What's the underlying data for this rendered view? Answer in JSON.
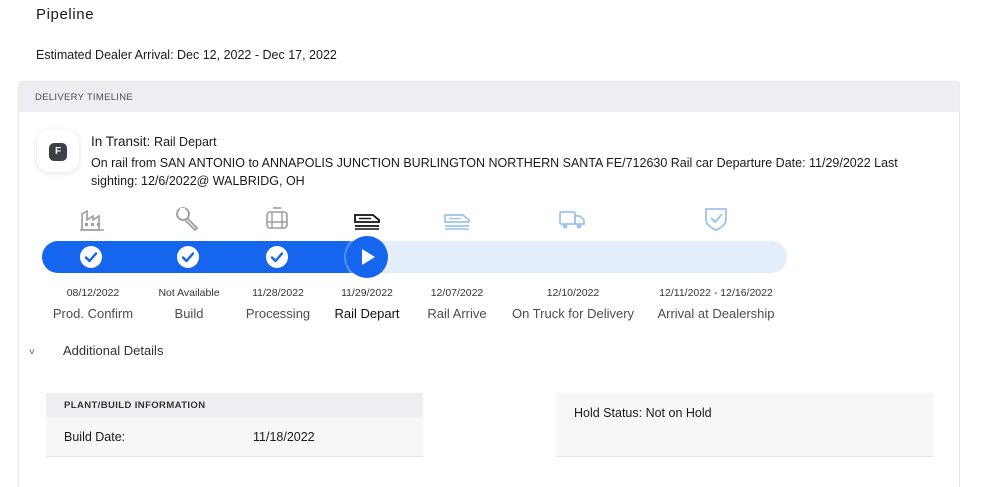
{
  "page": {
    "title": "Pipeline",
    "estimated_arrival": "Estimated Dealer Arrival: Dec 12, 2022 - Dec 17, 2022"
  },
  "timeline": {
    "header": "DELIVERY TIMELINE",
    "badge_letter": "F",
    "status_title": "In Transit:",
    "status_sub": "Rail Depart",
    "status_detail": "On rail from SAN ANTONIO to ANNAPOLIS JUNCTION BURLINGTON NORTHERN SANTA FE/712630 Rail car Departure Date: 11/29/2022 Last sighting: 12/6/2022@ WALBRIDG, OH",
    "steps": [
      {
        "date": "08/12/2022",
        "label": "Prod. Confirm",
        "icon": "factory-icon",
        "state": "complete"
      },
      {
        "date": "Not Available",
        "label": "Build",
        "icon": "wrench-icon",
        "state": "complete"
      },
      {
        "date": "11/28/2022",
        "label": "Processing",
        "icon": "car-seat-icon",
        "state": "complete"
      },
      {
        "date": "11/29/2022",
        "label": "Rail Depart",
        "icon": "train-icon",
        "state": "current"
      },
      {
        "date": "12/07/2022",
        "label": "Rail Arrive",
        "icon": "train-icon",
        "state": "upcoming"
      },
      {
        "date": "12/10/2022",
        "label": "On Truck for Delivery",
        "icon": "truck-icon",
        "state": "upcoming"
      },
      {
        "date": "12/11/2022 - 12/16/2022",
        "label": "Arrival at Dealership",
        "icon": "shield-check-icon",
        "state": "upcoming"
      }
    ],
    "colors": {
      "accent": "#1565ee",
      "track": "#e4edfb",
      "icon_done": "#9a9da3",
      "icon_upcoming": "#9cc4ee"
    }
  },
  "details": {
    "toggle_label": "Additional Details",
    "plant_header": "PLANT/BUILD INFORMATION",
    "build_date_label": "Build Date:",
    "build_date_value": "11/18/2022",
    "hold_status": "Hold Status: Not on Hold"
  }
}
